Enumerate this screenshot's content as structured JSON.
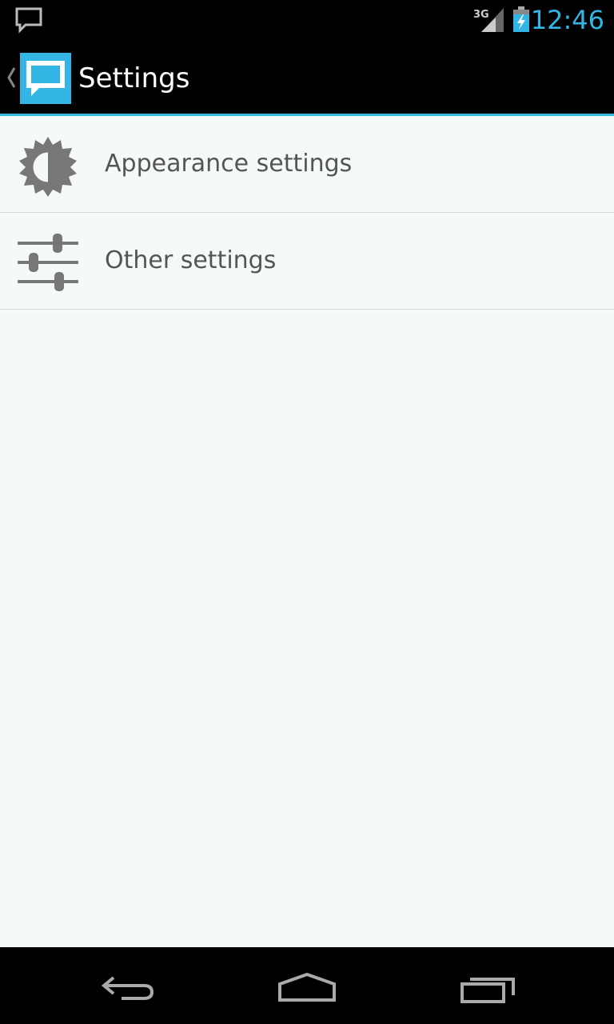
{
  "status_bar": {
    "network": "3G",
    "time": "12:46",
    "accent_color": "#33b5e5"
  },
  "action_bar": {
    "title": "Settings",
    "icon": "chat-bubble-icon"
  },
  "settings_list": [
    {
      "label": "Appearance settings",
      "icon": "brightness-gear-icon"
    },
    {
      "label": "Other settings",
      "icon": "sliders-icon"
    }
  ],
  "nav_bar": {
    "buttons": [
      "back-icon",
      "home-icon",
      "recents-icon"
    ]
  }
}
